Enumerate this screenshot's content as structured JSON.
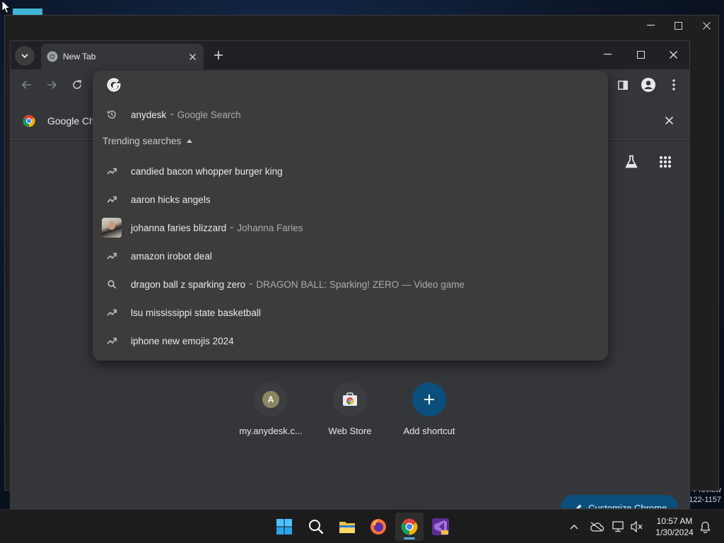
{
  "desktop": {
    "preview_lines": [
      "Preview",
      "122-1157"
    ]
  },
  "chrome": {
    "tab_title": "New Tab",
    "infobar_text": "Google Ch",
    "shortcuts": [
      {
        "label": "my.anydesk.c...",
        "initial": "A"
      },
      {
        "label": "Web Store"
      },
      {
        "label": "Add shortcut"
      }
    ],
    "customize_label": "Customize Chrome"
  },
  "omnibox": {
    "history_item": {
      "text": "anydesk",
      "desc": "Google Search"
    },
    "trending_label": "Trending searches",
    "trending": [
      {
        "icon": "trending-icon",
        "text": "candied bacon whopper burger king",
        "desc": ""
      },
      {
        "icon": "trending-icon",
        "text": "aaron hicks angels",
        "desc": ""
      },
      {
        "icon": "thumbnail",
        "text": "johanna faries blizzard",
        "desc": "Johanna Faries"
      },
      {
        "icon": "trending-icon",
        "text": "amazon irobot deal",
        "desc": ""
      },
      {
        "icon": "search-icon",
        "text": "dragon ball z sparking zero",
        "desc": "DRAGON BALL: Sparking! ZERO — Video game"
      },
      {
        "icon": "trending-icon",
        "text": "lsu mississippi state basketball",
        "desc": ""
      },
      {
        "icon": "trending-icon",
        "text": "iphone new emojis 2024",
        "desc": ""
      }
    ],
    "separator": "-"
  },
  "taskbar": {
    "time": "10:57 AM",
    "date": "1/30/2024"
  }
}
